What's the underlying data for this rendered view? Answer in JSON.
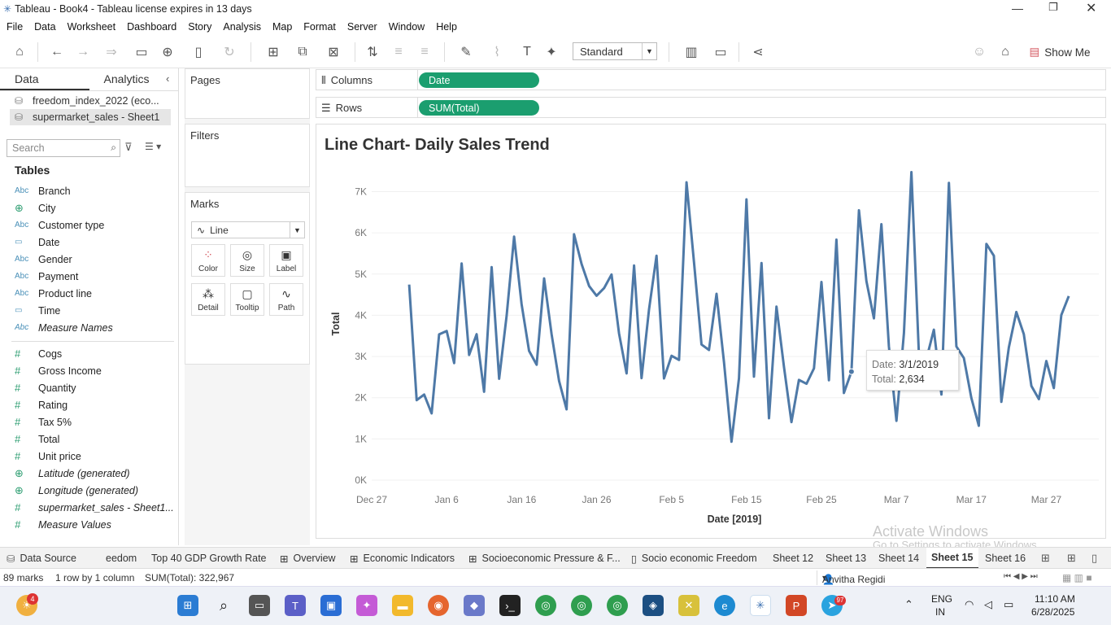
{
  "window": {
    "title": "Tableau - Book4 - Tableau license expires in 13 days"
  },
  "menu": [
    "File",
    "Data",
    "Worksheet",
    "Dashboard",
    "Story",
    "Analysis",
    "Map",
    "Format",
    "Server",
    "Window",
    "Help"
  ],
  "toolbar": {
    "fit_mode": "Standard",
    "show_me": "Show Me"
  },
  "left_pane": {
    "tabs": [
      "Data",
      "Analytics"
    ],
    "datasources": [
      "freedom_index_2022 (eco...",
      "supermarket_sales - Sheet1"
    ],
    "search_placeholder": "Search",
    "tables_header": "Tables",
    "dimensions": [
      {
        "name": "Branch",
        "type": "Abc"
      },
      {
        "name": "City",
        "type": "geo"
      },
      {
        "name": "Customer type",
        "type": "Abc"
      },
      {
        "name": "Date",
        "type": "date"
      },
      {
        "name": "Gender",
        "type": "Abc"
      },
      {
        "name": "Payment",
        "type": "Abc"
      },
      {
        "name": "Product line",
        "type": "Abc"
      },
      {
        "name": "Time",
        "type": "datetime"
      },
      {
        "name": "Measure Names",
        "type": "Abc"
      }
    ],
    "measures": [
      "Cogs",
      "Gross Income",
      "Quantity",
      "Rating",
      "Tax 5%",
      "Total",
      "Unit price",
      "Latitude (generated)",
      "Longitude (generated)",
      "supermarket_sales - Sheet1...",
      "Measure Values"
    ]
  },
  "cards": {
    "pages": "Pages",
    "filters": "Filters",
    "marks": "Marks",
    "mark_type": "Line",
    "mark_buttons": [
      "Color",
      "Size",
      "Label",
      "Detail",
      "Tooltip",
      "Path"
    ]
  },
  "shelves": {
    "columns_label": "Columns",
    "columns_pill": "Date",
    "rows_label": "Rows",
    "rows_pill": "SUM(Total)"
  },
  "chart_data": {
    "type": "line",
    "title": "Line Chart- Daily Sales Trend",
    "xlabel": "Date [2019]",
    "ylabel": "Total",
    "x_ticks": [
      "Dec 27",
      "Jan 6",
      "Jan 16",
      "Jan 26",
      "Feb 5",
      "Feb 15",
      "Feb 25",
      "Mar 7",
      "Mar 17",
      "Mar 27"
    ],
    "y_ticks": [
      "0K",
      "1K",
      "2K",
      "3K",
      "4K",
      "5K",
      "6K",
      "7K"
    ],
    "ylim": [
      0,
      7800
    ],
    "x_start": "2019-01-01",
    "series": [
      {
        "values": [
          4745,
          1942,
          2077,
          1620,
          3537,
          3620,
          2839,
          5259,
          3039,
          3541,
          2145,
          5167,
          2461,
          3987,
          5908,
          4271,
          3138,
          2800,
          4896,
          3541,
          2407,
          1717,
          5965,
          5243,
          4712,
          4474,
          4659,
          4990,
          3562,
          2588,
          5207,
          2476,
          4142,
          5446,
          2469,
          3018,
          2916,
          7228,
          5287,
          3291,
          3157,
          4522,
          2857,
          933,
          2472,
          6813,
          2512,
          5269,
          1503,
          4210,
          2751,
          1407,
          2432,
          2338,
          2714,
          4809,
          2424,
          5835,
          2115,
          2634,
          6548,
          4826,
          3925,
          6210,
          3251,
          1439,
          3566,
          7475,
          3061,
          2934,
          3652,
          2078,
          7214,
          3245,
          2962,
          1995,
          1319,
          5732,
          5444,
          1900,
          3220,
          4080,
          3543,
          2287,
          1966,
          2890,
          2233,
          4005,
          4467
        ]
      }
    ]
  },
  "tooltip": {
    "date_label": "Date:",
    "date_value": "3/1/2019",
    "total_label": "Total:",
    "total_value": "2,634"
  },
  "watermark": {
    "line1": "Activate Windows",
    "line2": "Go to Settings to activate Windows."
  },
  "sheet_tabs": [
    "Data Source",
    "eedom",
    "Top 40 GDP Growth Rate",
    "Overview",
    "Economic Indicators",
    "Socioeconomic Pressure & F...",
    "Socio economic Freedom",
    "Sheet 12",
    "Sheet 13",
    "Sheet 14",
    "Sheet 15",
    "Sheet 16"
  ],
  "status": {
    "marks": "89 marks",
    "dims": "1 row by 1 column",
    "sum": "SUM(Total): 322,967",
    "user": "Anvitha Regidi"
  },
  "taskbar": {
    "lang1": "ENG",
    "lang2": "IN",
    "time": "11:10 AM",
    "date": "6/28/2025",
    "badge_weather": "4",
    "badge_telegram": "97"
  }
}
